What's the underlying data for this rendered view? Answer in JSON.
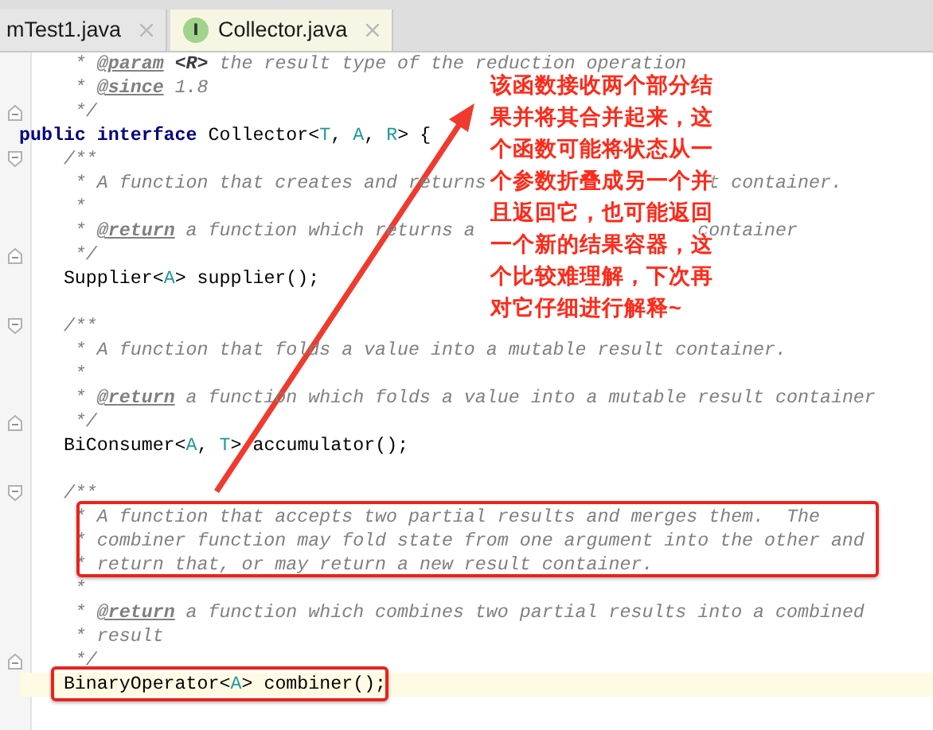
{
  "tabs": [
    {
      "label": "mTest1.java",
      "selected": false
    },
    {
      "label": "Collector.java",
      "selected": true,
      "icon_letter": "I"
    }
  ],
  "code_lines": [
    {
      "kind": "code",
      "segments": [
        {
          "text": "     * ",
          "kind": "comment"
        },
        {
          "text": "@param",
          "kind": "doctag"
        },
        {
          "text": " <R>",
          "kind": "docparam"
        },
        {
          "text": " the result type of the reduction operation",
          "kind": "comment"
        }
      ]
    },
    {
      "kind": "code",
      "segments": [
        {
          "text": "     * ",
          "kind": "comment"
        },
        {
          "text": "@since",
          "kind": "doctag"
        },
        {
          "text": " 1.8",
          "kind": "comment"
        }
      ]
    },
    {
      "kind": "code",
      "fold_end": true,
      "segments": [
        {
          "text": "     */",
          "kind": "comment"
        }
      ]
    },
    {
      "kind": "code",
      "segments": [
        {
          "text": "public interface",
          "kind": "keyword"
        },
        {
          "text": " Collector<",
          "kind": "plain"
        },
        {
          "text": "T",
          "kind": "typeparam"
        },
        {
          "text": ", ",
          "kind": "plain"
        },
        {
          "text": "A",
          "kind": "typeparam"
        },
        {
          "text": ", ",
          "kind": "plain"
        },
        {
          "text": "R",
          "kind": "typeparam"
        },
        {
          "text": "> {",
          "kind": "plain"
        }
      ]
    },
    {
      "kind": "code",
      "fold_start": true,
      "segments": [
        {
          "text": "    /**",
          "kind": "comment"
        }
      ]
    },
    {
      "kind": "code",
      "segments": [
        {
          "text": "     * A function that creates and returns",
          "kind": "comment"
        },
        {
          "text": "t container.",
          "kind": "comment",
          "after_gap": true
        }
      ]
    },
    {
      "kind": "code",
      "segments": [
        {
          "text": "     *",
          "kind": "comment"
        }
      ]
    },
    {
      "kind": "code",
      "segments": [
        {
          "text": "     * ",
          "kind": "comment"
        },
        {
          "text": "@return",
          "kind": "doctag"
        },
        {
          "text": " a function which returns a",
          "kind": "comment"
        },
        {
          "text": "container",
          "kind": "comment",
          "after_gap": true
        }
      ]
    },
    {
      "kind": "code",
      "fold_end": true,
      "segments": [
        {
          "text": "     */",
          "kind": "comment"
        }
      ]
    },
    {
      "kind": "code",
      "segments": [
        {
          "text": "    Supplier<",
          "kind": "plain"
        },
        {
          "text": "A",
          "kind": "typeparam"
        },
        {
          "text": "> supplier();",
          "kind": "plain"
        }
      ]
    },
    {
      "kind": "blank"
    },
    {
      "kind": "code",
      "fold_start": true,
      "segments": [
        {
          "text": "    /**",
          "kind": "comment"
        }
      ]
    },
    {
      "kind": "code",
      "segments": [
        {
          "text": "     * A function that folds a value into a mutable result container.",
          "kind": "comment"
        }
      ]
    },
    {
      "kind": "code",
      "segments": [
        {
          "text": "     *",
          "kind": "comment"
        }
      ]
    },
    {
      "kind": "code",
      "segments": [
        {
          "text": "     * ",
          "kind": "comment"
        },
        {
          "text": "@return",
          "kind": "doctag"
        },
        {
          "text": " a function which folds a value into a mutable result container",
          "kind": "comment"
        }
      ]
    },
    {
      "kind": "code",
      "fold_end": true,
      "segments": [
        {
          "text": "     */",
          "kind": "comment"
        }
      ]
    },
    {
      "kind": "code",
      "segments": [
        {
          "text": "    BiConsumer<",
          "kind": "plain"
        },
        {
          "text": "A",
          "kind": "typeparam"
        },
        {
          "text": ", ",
          "kind": "plain"
        },
        {
          "text": "T",
          "kind": "typeparam"
        },
        {
          "text": "> accumulator();",
          "kind": "plain"
        }
      ]
    },
    {
      "kind": "blank"
    },
    {
      "kind": "code",
      "fold_start": true,
      "segments": [
        {
          "text": "    /**",
          "kind": "comment"
        }
      ]
    },
    {
      "kind": "code",
      "segments": [
        {
          "text": "     * A function that accepts two partial results and merges them.  The",
          "kind": "comment"
        }
      ]
    },
    {
      "kind": "code",
      "segments": [
        {
          "text": "     * combiner function may fold state from one argument into the other and",
          "kind": "comment"
        }
      ]
    },
    {
      "kind": "code",
      "segments": [
        {
          "text": "     * return that, or may return a new result container.",
          "kind": "comment"
        }
      ]
    },
    {
      "kind": "code",
      "segments": [
        {
          "text": "     *",
          "kind": "comment"
        }
      ]
    },
    {
      "kind": "code",
      "segments": [
        {
          "text": "     * ",
          "kind": "comment"
        },
        {
          "text": "@return",
          "kind": "doctag"
        },
        {
          "text": " a function which combines two partial results into a combined",
          "kind": "comment"
        }
      ]
    },
    {
      "kind": "code",
      "segments": [
        {
          "text": "     * result",
          "kind": "comment"
        }
      ]
    },
    {
      "kind": "code",
      "fold_end": true,
      "segments": [
        {
          "text": "     */",
          "kind": "comment"
        }
      ]
    },
    {
      "kind": "code",
      "current": true,
      "segments": [
        {
          "text": "    BinaryOperator<",
          "kind": "plain"
        },
        {
          "text": "A",
          "kind": "typeparam"
        },
        {
          "text": "> combiner();",
          "kind": "plain"
        }
      ]
    },
    {
      "kind": "blank"
    }
  ],
  "annotation": {
    "lines": [
      "该函数接收两个部分结",
      "果并将其合并起来，这",
      "个函数可能将状态从一",
      "个参数折叠成另一个并",
      "且返回它，也可能返回",
      "一个新的结果容器，这",
      "个比较难理解，下次再",
      "对它仔细进行解释~"
    ]
  }
}
